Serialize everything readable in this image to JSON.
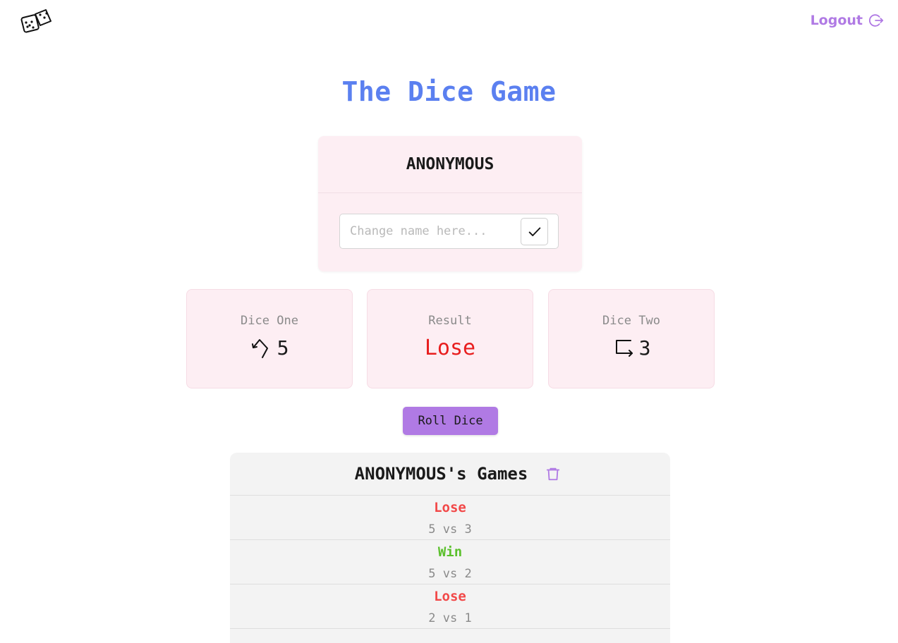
{
  "header": {
    "logo_icon": "dice-icon",
    "logout_label": "Logout",
    "logout_icon": "logout-icon"
  },
  "title": "The Dice Game",
  "player": {
    "name": "ANONYMOUS",
    "name_input_placeholder": "Change name here...",
    "name_input_value": "",
    "confirm_icon": "check-icon"
  },
  "dice_one": {
    "label": "Dice One",
    "value": "5",
    "icon": "arrow-bend-down-left-icon"
  },
  "result": {
    "label": "Result",
    "value": "Lose"
  },
  "dice_two": {
    "label": "Dice Two",
    "value": "3",
    "icon": "arrow-bend-down-right-icon"
  },
  "roll_button_label": "Roll Dice",
  "games": {
    "title": "ANONYMOUS's Games",
    "delete_icon": "trash-icon",
    "items": [
      {
        "outcome": "Lose",
        "score": "5 vs 3"
      },
      {
        "outcome": "Win",
        "score": "5 vs 2"
      },
      {
        "outcome": "Lose",
        "score": "2 vs 1"
      }
    ]
  },
  "colors": {
    "accent": "#b07ae4",
    "title": "#5b80f0",
    "card": "#fdeef3",
    "lose": "#f24848",
    "win": "#5bc02c",
    "result_lose": "#e81e1e"
  }
}
